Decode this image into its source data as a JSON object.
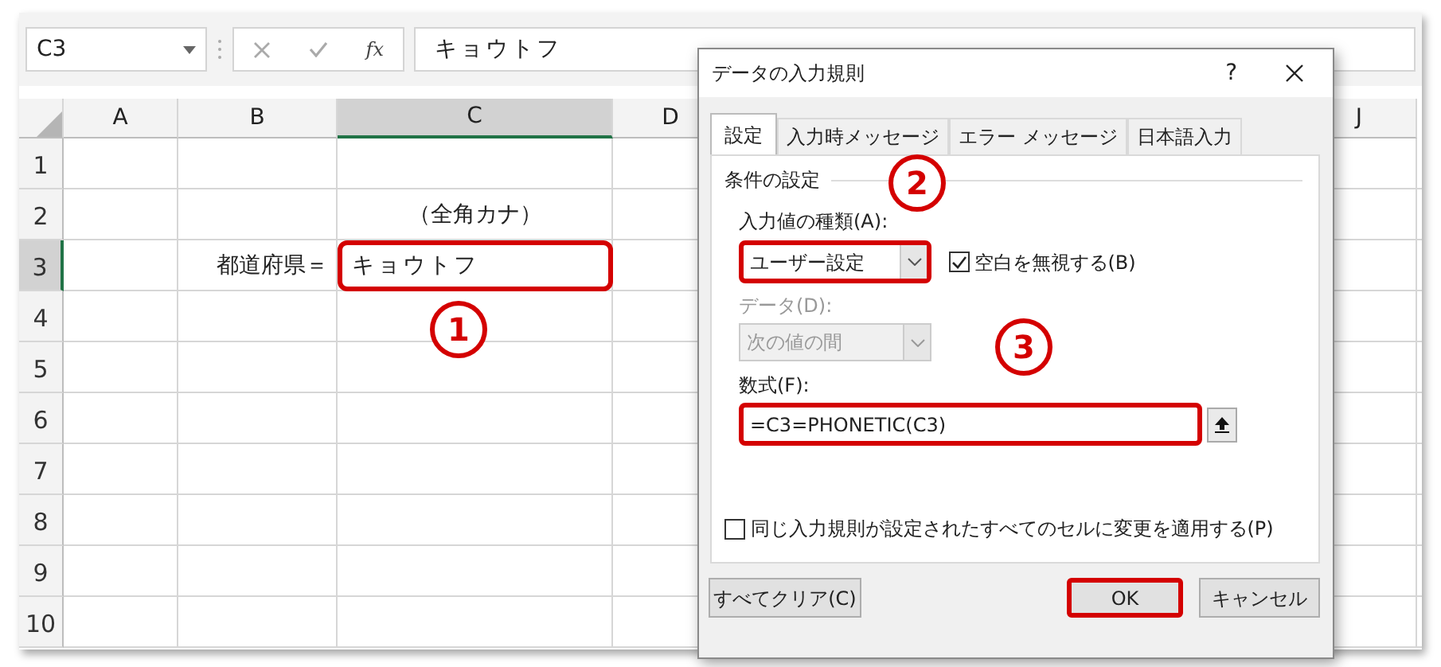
{
  "name_box": {
    "value": "C3"
  },
  "formula_bar": {
    "function_label": "fx",
    "value": "キョウトフ"
  },
  "columns": [
    {
      "label": "A",
      "selected": false
    },
    {
      "label": "B",
      "selected": false
    },
    {
      "label": "C",
      "selected": true
    },
    {
      "label": "D",
      "selected": false
    },
    {
      "label": "J",
      "selected": false
    }
  ],
  "rows": [
    {
      "label": "1",
      "selected": false
    },
    {
      "label": "2",
      "selected": false,
      "c": {
        "text": "（全角カナ）",
        "highlighted": false
      }
    },
    {
      "label": "3",
      "selected": true,
      "b": {
        "text": "都道府県＝",
        "highlighted": false
      },
      "c": {
        "text": "キョウトフ",
        "highlighted": true
      }
    },
    {
      "label": "4",
      "selected": false
    },
    {
      "label": "5",
      "selected": false
    },
    {
      "label": "6",
      "selected": false
    },
    {
      "label": "7",
      "selected": false
    },
    {
      "label": "8",
      "selected": false
    },
    {
      "label": "9",
      "selected": false
    },
    {
      "label": "10",
      "selected": false
    }
  ],
  "dialog": {
    "title": "データの入力規則",
    "help": "?",
    "tabs": [
      {
        "label": "設定",
        "selected": true
      },
      {
        "label": "入力時メッセージ",
        "selected": false
      },
      {
        "label": "エラー メッセージ",
        "selected": false
      },
      {
        "label": "日本語入力",
        "selected": false
      }
    ],
    "criteria": {
      "heading": "条件の設定",
      "allow": {
        "label": "入力値の種類(A):",
        "value": "ユーザー設定",
        "highlighted": true,
        "disabled": false
      },
      "ignore_blank": {
        "label": "空白を無視する(B)",
        "checked": true
      },
      "data": {
        "label": "データ(D):",
        "value": "次の値の間",
        "disabled": true
      },
      "formula": {
        "label": "数式(F):",
        "value": "=C3=PHONETIC(C3)",
        "highlighted": true
      }
    },
    "apply_all": {
      "label": "同じ入力規則が設定されたすべてのセルに変更を適用する(P)",
      "checked": false
    },
    "buttons": [
      {
        "label": "すべてクリア(C)",
        "highlighted": false
      },
      {
        "label": "OK",
        "highlighted": true
      },
      {
        "label": "キャンセル",
        "highlighted": false
      }
    ]
  },
  "callouts": [
    {
      "label": "1"
    },
    {
      "label": "2"
    },
    {
      "label": "3"
    }
  ]
}
